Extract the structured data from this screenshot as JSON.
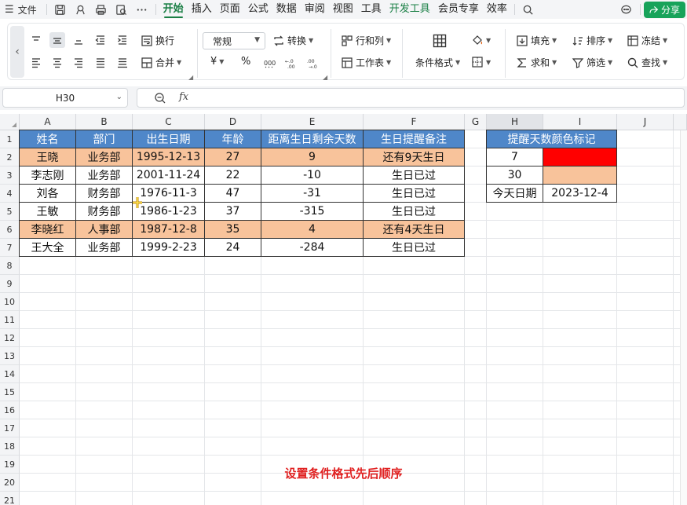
{
  "menu": {
    "file_label": "文件",
    "tabs": [
      "开始",
      "插入",
      "页面",
      "公式",
      "数据",
      "审阅",
      "视图",
      "工具",
      "开发工具",
      "会员专享",
      "效率"
    ],
    "active_tab": "开始",
    "share_label": "分享"
  },
  "ribbon": {
    "wrap_label": "换行",
    "merge_label": "合并",
    "font_name": "常规",
    "convert_label": "转换",
    "currency_symbol": "¥",
    "percent_symbol": "%",
    "rowcol_label": "行和列",
    "sheet_label": "工作表",
    "cond_format_label": "条件格式",
    "fill_label": "填充",
    "sort_label": "排序",
    "freeze_label": "冻结",
    "sum_label": "求和",
    "filter_label": "筛选",
    "find_label": "查找"
  },
  "formula_bar": {
    "cell_ref": "H30",
    "fx_label": "fx",
    "value": ""
  },
  "sheet": {
    "columns": [
      "A",
      "B",
      "C",
      "D",
      "E",
      "F",
      "G",
      "H",
      "I",
      "J"
    ],
    "selected_column": "H",
    "rows": [
      "1",
      "2",
      "3",
      "4",
      "5",
      "6",
      "7",
      "8",
      "9",
      "10",
      "11",
      "12",
      "13",
      "14",
      "15",
      "16",
      "17",
      "18",
      "19",
      "20",
      "21"
    ],
    "table": {
      "headers": [
        "姓名",
        "部门",
        "出生日期",
        "年龄",
        "距离生日剩余天数",
        "生日提醒备注"
      ],
      "rows": [
        {
          "cells": [
            "王晓",
            "业务部",
            "1995-12-13",
            "27",
            "9",
            "还有9天生日"
          ],
          "highlight": "orange"
        },
        {
          "cells": [
            "李志刚",
            "业务部",
            "2001-11-24",
            "22",
            "-10",
            "生日已过"
          ],
          "highlight": "none"
        },
        {
          "cells": [
            "刘各",
            "财务部",
            "1976-11-3",
            "47",
            "-31",
            "生日已过"
          ],
          "highlight": "none"
        },
        {
          "cells": [
            "王敏",
            "财务部",
            "1986-1-23",
            "37",
            "-315",
            "生日已过"
          ],
          "highlight": "none"
        },
        {
          "cells": [
            "李晓红",
            "人事部",
            "1987-12-8",
            "35",
            "4",
            "还有4天生日"
          ],
          "highlight": "orange"
        },
        {
          "cells": [
            "王大全",
            "业务部",
            "1999-2-23",
            "24",
            "-284",
            "生日已过"
          ],
          "highlight": "none"
        }
      ]
    },
    "legend_table": {
      "title": "提醒天数颜色标记",
      "rows": [
        {
          "label": "7",
          "value": "",
          "color": "#ff0000"
        },
        {
          "label": "30",
          "value": "",
          "color": "#f8c39b"
        },
        {
          "label": "今天日期",
          "value": "2023-12-4",
          "color": ""
        }
      ]
    },
    "caption": "设置条件格式先后顺序"
  },
  "colors": {
    "header_blue": "#4f87c9",
    "highlight_orange": "#f8c39b",
    "marker_red": "#ff0000",
    "accent_green": "#1a7f45",
    "caption_red": "#e02020"
  }
}
